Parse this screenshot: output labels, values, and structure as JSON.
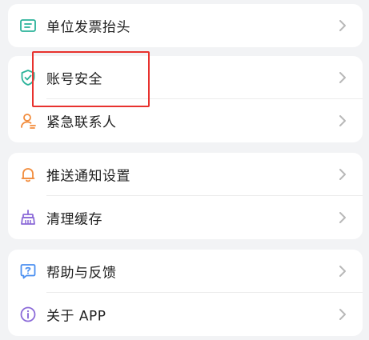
{
  "groups": [
    {
      "items": [
        {
          "label": "单位发票抬头",
          "icon": "invoice-ticket-icon"
        }
      ]
    },
    {
      "items": [
        {
          "label": "账号安全",
          "icon": "shield-check-icon"
        },
        {
          "label": "紧急联系人",
          "icon": "contact-person-icon"
        }
      ]
    },
    {
      "items": [
        {
          "label": "推送通知设置",
          "icon": "bell-icon"
        },
        {
          "label": "清理缓存",
          "icon": "broom-icon"
        }
      ]
    },
    {
      "items": [
        {
          "label": "帮助与反馈",
          "icon": "help-question-icon"
        },
        {
          "label": "关于 APP",
          "icon": "info-icon"
        }
      ]
    }
  ],
  "colors": {
    "background": "#f2f3f5",
    "card": "#ffffff",
    "text": "#1f1f1f",
    "chevron": "#b8b8b8",
    "teal_icon": "#2bb39a",
    "orange_icon": "#f28c3c",
    "purple_icon": "#8b6ad8",
    "blue_icon": "#4a8ff0",
    "highlight_box": "#e8322e"
  }
}
